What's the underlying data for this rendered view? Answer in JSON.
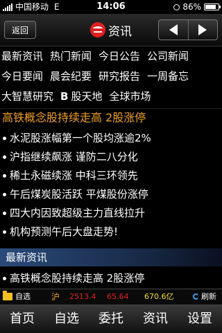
{
  "status_bar": {
    "carrier": "中国移动",
    "network": "E",
    "time": "14:06",
    "battery_percent": "86%",
    "battery_level": 0.86,
    "icons": [
      "signal-icon",
      "alarm-clock-icon",
      "battery-icon"
    ]
  },
  "header": {
    "back_label": "返回",
    "title": "资讯",
    "logo_icon": "news-logo-icon",
    "prev_icon": "arrow-left-icon",
    "next_icon": "arrow-right-icon",
    "logo_color": "#e02020"
  },
  "categories": [
    [
      "最新资讯",
      "热门新闻",
      "今日公告",
      "公司新闻"
    ],
    [
      "今日要闻",
      "晨会纪要",
      "研究报告",
      "一周备忘"
    ],
    [
      "大智慧研究",
      "B",
      "股天地",
      "全球市场"
    ]
  ],
  "headline": {
    "text": "高铁概念股持续走高  2股涨停",
    "color": "#f0a020"
  },
  "news_items": [
    "水泥股涨幅第一个股均涨逾2%",
    "沪指继续飙涨  谨防二八分化",
    "稀土永磁续涨  中科三环领先",
    "午后煤炭股活跃  平煤股份涨停",
    "四大内因致超级主力直线拉升",
    "机构预测午后大盘走势!"
  ],
  "section": {
    "title": "最新资讯",
    "items": [
      "高铁概念股持续走高  2股涨停"
    ]
  },
  "ticker": {
    "favorites_label": "自选",
    "market": "沪",
    "index_value": "2513.4",
    "change": "65.64",
    "amount": "670.6亿",
    "refresh_label": "刷新",
    "up_color": "#e02020"
  },
  "tabbar": {
    "items": [
      "首页",
      "自选",
      "委托",
      "资讯",
      "设置"
    ]
  }
}
